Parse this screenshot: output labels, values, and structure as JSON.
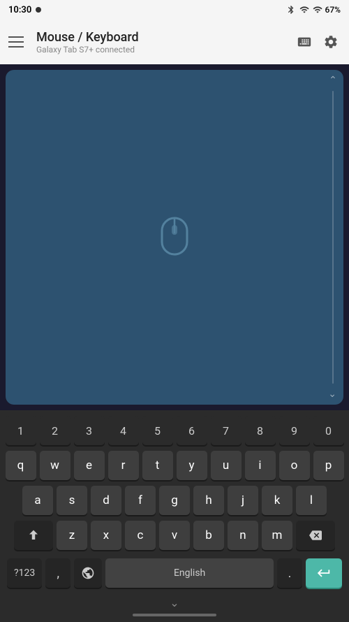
{
  "statusBar": {
    "time": "10:30",
    "battery": "67%"
  },
  "appBar": {
    "title": "Mouse / Keyboard",
    "subtitle": "Galaxy Tab S7+ connected"
  },
  "keyboard": {
    "row1": [
      "1",
      "2",
      "3",
      "4",
      "5",
      "6",
      "7",
      "8",
      "9",
      "0"
    ],
    "row2": [
      "q",
      "w",
      "e",
      "r",
      "t",
      "y",
      "u",
      "i",
      "o",
      "p"
    ],
    "row3": [
      "a",
      "s",
      "d",
      "f",
      "g",
      "h",
      "j",
      "k",
      "l"
    ],
    "row4": [
      "z",
      "x",
      "c",
      "v",
      "b",
      "n",
      "m"
    ],
    "sym_label": "?123",
    "comma_label": ",",
    "space_label": "English",
    "period_label": ".",
    "chevron_label": "∧"
  }
}
